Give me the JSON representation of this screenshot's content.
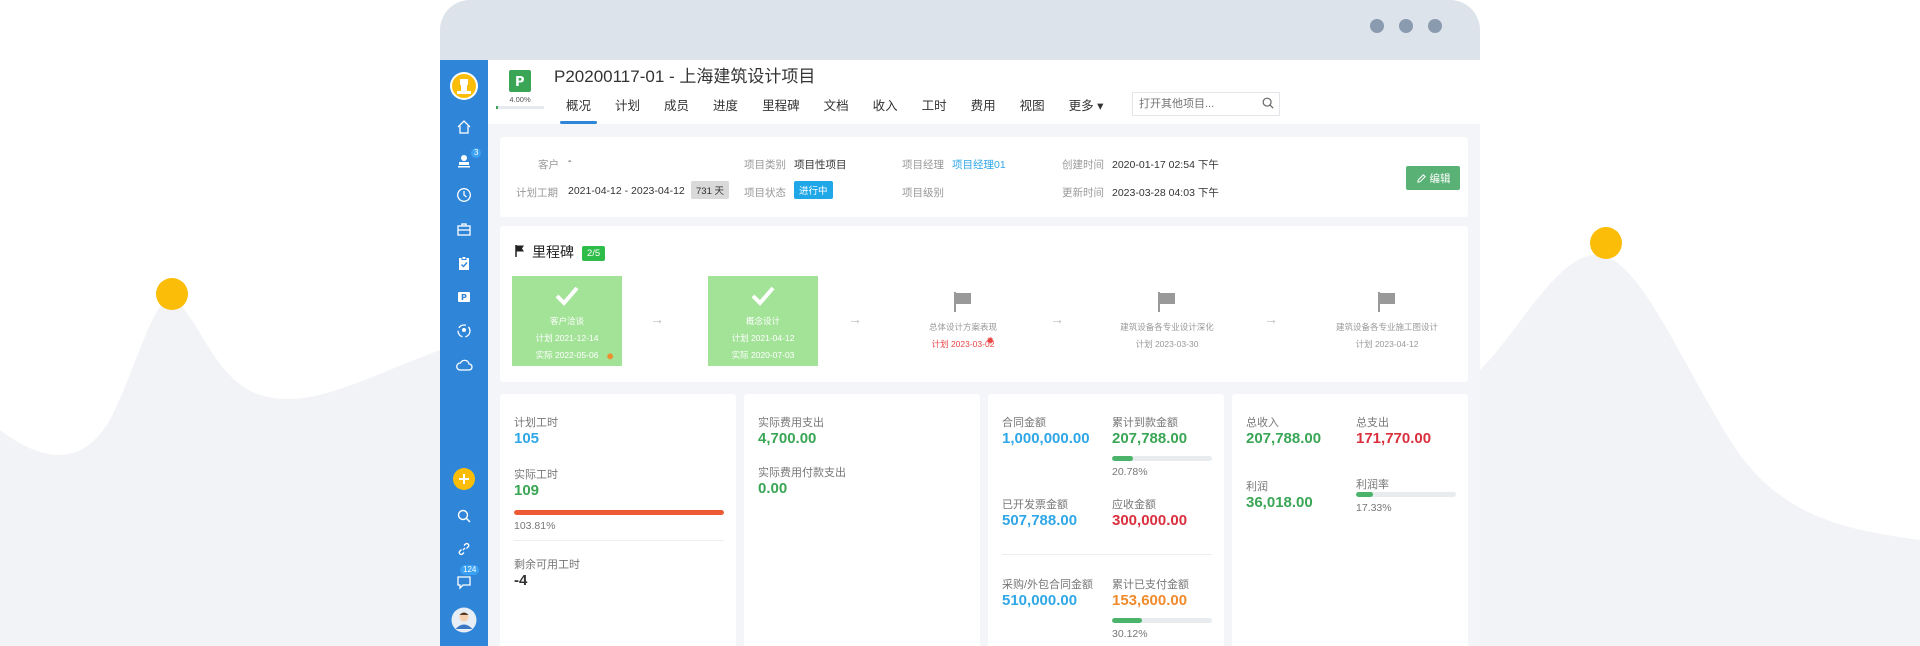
{
  "project": {
    "title": "P20200117-01 - 上海建筑设计项目",
    "progress_percent": 4.0,
    "progress_label": "4.00%"
  },
  "tabs": [
    {
      "label": "概况",
      "active": true
    },
    {
      "label": "计划"
    },
    {
      "label": "成员"
    },
    {
      "label": "进度"
    },
    {
      "label": "里程碑"
    },
    {
      "label": "文档"
    },
    {
      "label": "收入"
    },
    {
      "label": "工时"
    },
    {
      "label": "费用"
    },
    {
      "label": "视图"
    },
    {
      "label": "更多 ▾"
    }
  ],
  "search": {
    "placeholder": "打开其他项目..."
  },
  "sidebar": {
    "badge_tasks": "3",
    "badge_messages": "124"
  },
  "info": {
    "customer_label": "客户",
    "customer_value": "-",
    "plan_period_label": "计划工期",
    "plan_period_value": "2021-04-12 - 2023-04-12",
    "plan_days": "731 天",
    "type_label": "项目类别",
    "type_value": "项目性项目",
    "status_label": "项目状态",
    "status_value": "进行中",
    "manager_label": "项目经理",
    "manager_value": "项目经理01",
    "level_label": "项目级别",
    "created_label": "创建时间",
    "created_value": "2020-01-17 02:54 下午",
    "updated_label": "更新时间",
    "updated_value": "2023-03-28 04:03 下午",
    "edit_label": "编辑"
  },
  "milestones": {
    "title": "里程碑",
    "count": "2/5",
    "items": [
      {
        "name": "客户洽谈",
        "plan": "计划 2021-12-14",
        "actual": "实际 2022-05-06",
        "done": true
      },
      {
        "name": "概念设计",
        "plan": "计划 2021-04-12",
        "actual": "实际 2020-07-03",
        "done": true
      },
      {
        "name": "总体设计方案表现",
        "plan": "计划 2023-03-02",
        "done": false,
        "overdue": true
      },
      {
        "name": "建筑设备各专业设计深化",
        "plan": "计划 2023-03-30",
        "done": false
      },
      {
        "name": "建筑设备各专业施工图设计",
        "plan": "计划 2023-04-12",
        "done": false
      }
    ]
  },
  "hours": {
    "plan_label": "计划工时",
    "plan_value": "105",
    "actual_label": "实际工时",
    "actual_value": "109",
    "actual_percent": 103.81,
    "actual_percent_label": "103.81%",
    "remain_label": "剩余可用工时",
    "remain_value": "-4"
  },
  "expense": {
    "actual_label": "实际费用支出",
    "actual_value": "4,700.00",
    "paid_label": "实际费用付款支出",
    "paid_value": "0.00"
  },
  "contract": {
    "amount_label": "合同金额",
    "amount_value": "1,000,000.00",
    "received_label": "累计到款金额",
    "received_value": "207,788.00",
    "received_percent": 20.78,
    "received_percent_label": "20.78%",
    "invoiced_label": "已开发票金额",
    "invoiced_value": "507,788.00",
    "receivable_label": "应收金额",
    "receivable_value": "300,000.00",
    "purchase_label": "采购/外包合同金额",
    "purchase_value": "510,000.00",
    "paid_label": "累计已支付金额",
    "paid_value": "153,600.00",
    "paid_percent": 30.12,
    "paid_percent_label": "30.12%"
  },
  "finance": {
    "income_label": "总收入",
    "income_value": "207,788.00",
    "expense_label": "总支出",
    "expense_value": "171,770.00",
    "profit_label": "利润",
    "profit_value": "36,018.00",
    "margin_label": "利润率",
    "margin_percent": 17.33,
    "margin_percent_label": "17.33%"
  },
  "colors": {
    "primary": "#2f86d9",
    "accent_yellow": "#fbbd08",
    "green": "#3aa655",
    "red": "#d9303e",
    "orange": "#f08a2a",
    "blue_text": "#2fa7e6"
  }
}
